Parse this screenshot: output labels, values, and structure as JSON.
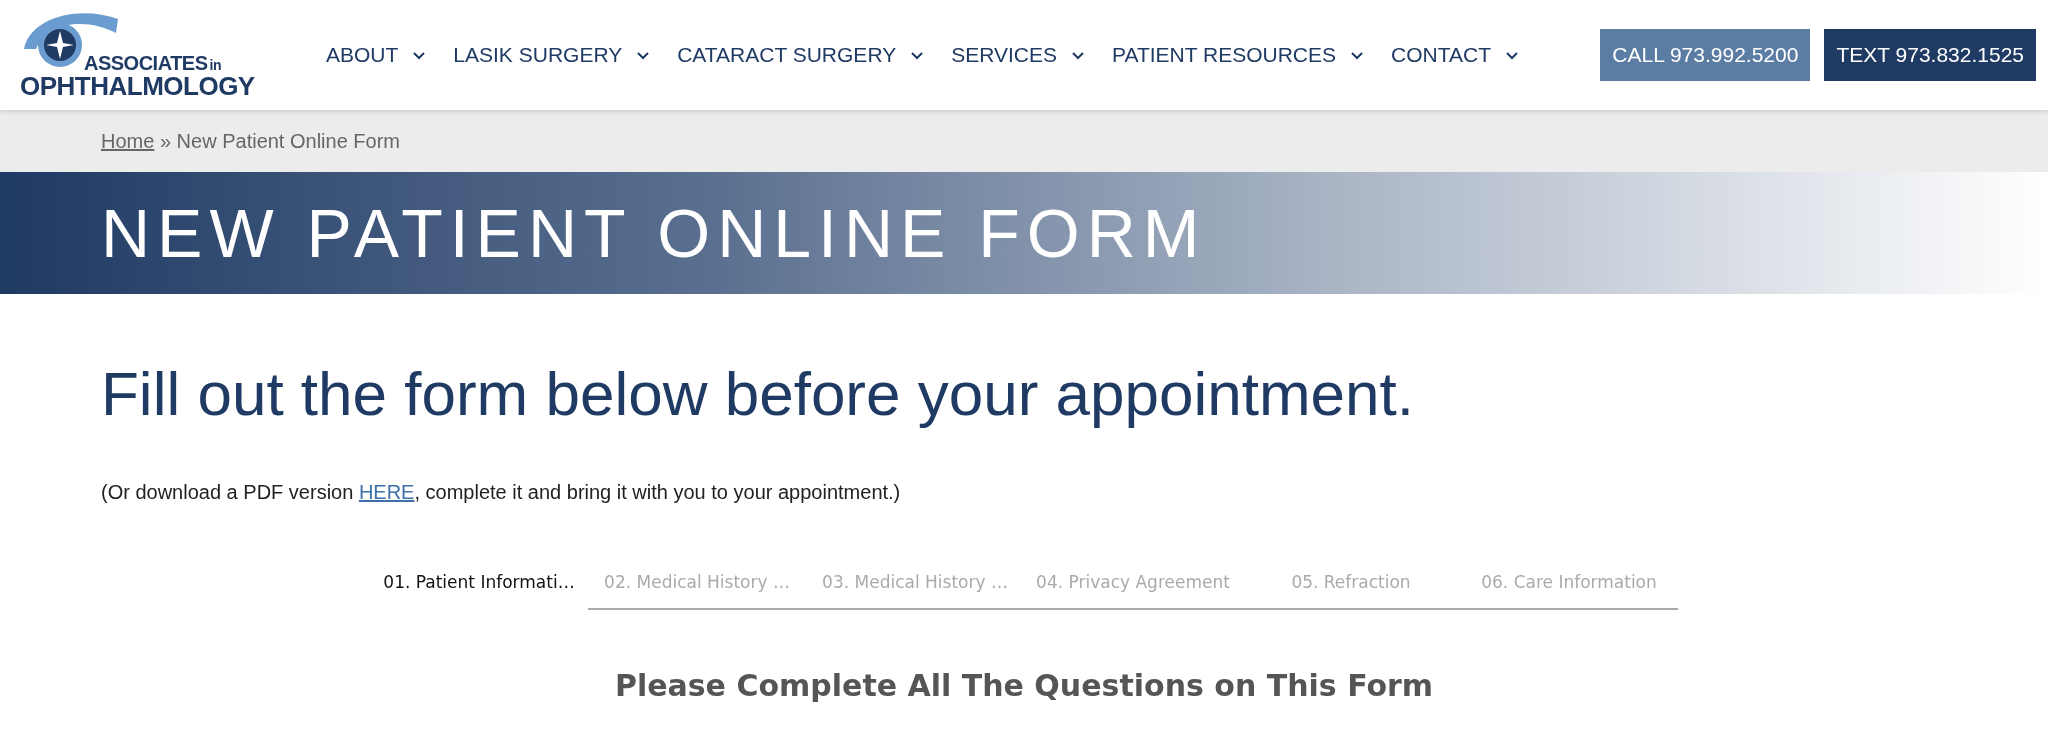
{
  "logo": {
    "line1": "ASSOCIATES",
    "line1_suffix": "in",
    "line2": "OPHTHALMOLOGY"
  },
  "nav": [
    {
      "label": "ABOUT"
    },
    {
      "label": "LASIK SURGERY"
    },
    {
      "label": "CATARACT SURGERY"
    },
    {
      "label": "SERVICES"
    },
    {
      "label": "PATIENT RESOURCES"
    },
    {
      "label": "CONTACT"
    }
  ],
  "actions": [
    {
      "kind": "call",
      "label": "CALL 973.992.5200"
    },
    {
      "kind": "text",
      "label": "TEXT 973.832.1525"
    }
  ],
  "breadcrumb": {
    "home": "Home",
    "separator": "»",
    "current": "New Patient Online Form"
  },
  "banner": {
    "title": "NEW PATIENT ONLINE FORM"
  },
  "heading": "Fill out the form below before your appointment.",
  "intro": {
    "before": "(Or download a PDF version ",
    "link": "HERE",
    "after": ", complete it and bring it with you to your appointment.)"
  },
  "steps": [
    {
      "label": "01. Patient Informati…",
      "selected": true
    },
    {
      "label": "02. Medical History …",
      "selected": false
    },
    {
      "label": "03. Medical History …",
      "selected": false
    },
    {
      "label": "04. Privacy Agreement",
      "selected": false
    },
    {
      "label": "05. Refraction",
      "selected": false
    },
    {
      "label": "06. Care Information",
      "selected": false
    }
  ],
  "form_title": "Please Complete All The Questions on This Form"
}
